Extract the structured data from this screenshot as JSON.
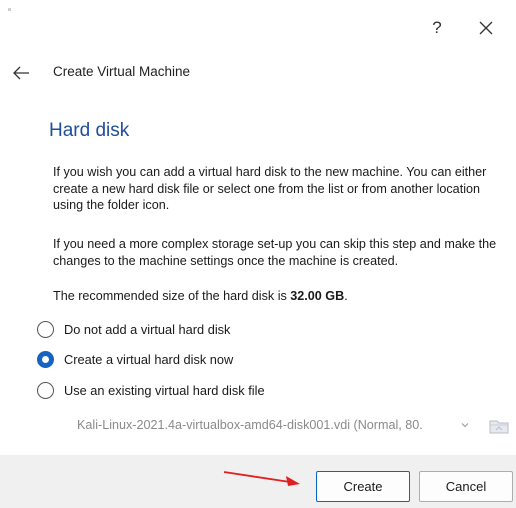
{
  "window": {
    "help_label": "?"
  },
  "wizard": {
    "title": "Create Virtual Machine"
  },
  "page": {
    "title": "Hard disk",
    "paragraph1": "If you wish you can add a virtual hard disk to the new machine. You can either create a new hard disk file or select one from the list or from another location using the folder icon.",
    "paragraph2": "If you need a more complex storage set-up you can skip this step and make the changes to the machine settings once the machine is created.",
    "recommended_prefix": "The recommended size of the hard disk is ",
    "recommended_size": "32.00 GB",
    "recommended_suffix": "."
  },
  "options": [
    {
      "label": "Do not add a virtual hard disk",
      "checked": false
    },
    {
      "label": "Create a virtual hard disk now",
      "checked": true
    },
    {
      "label": "Use an existing virtual hard disk file",
      "checked": false
    }
  ],
  "existing_disk": {
    "value": "Kali-Linux-2021.4a-virtualbox-amd64-disk001.vdi (Normal, 80."
  },
  "buttons": {
    "create": "Create",
    "cancel": "Cancel"
  },
  "colors": {
    "accent": "#1565c0",
    "title": "#1f4e9b",
    "annotation_arrow": "#e02020"
  },
  "icons": {
    "close": "close-icon",
    "back": "back-arrow-icon",
    "folder": "folder-icon",
    "chevron": "chevron-down-icon"
  }
}
